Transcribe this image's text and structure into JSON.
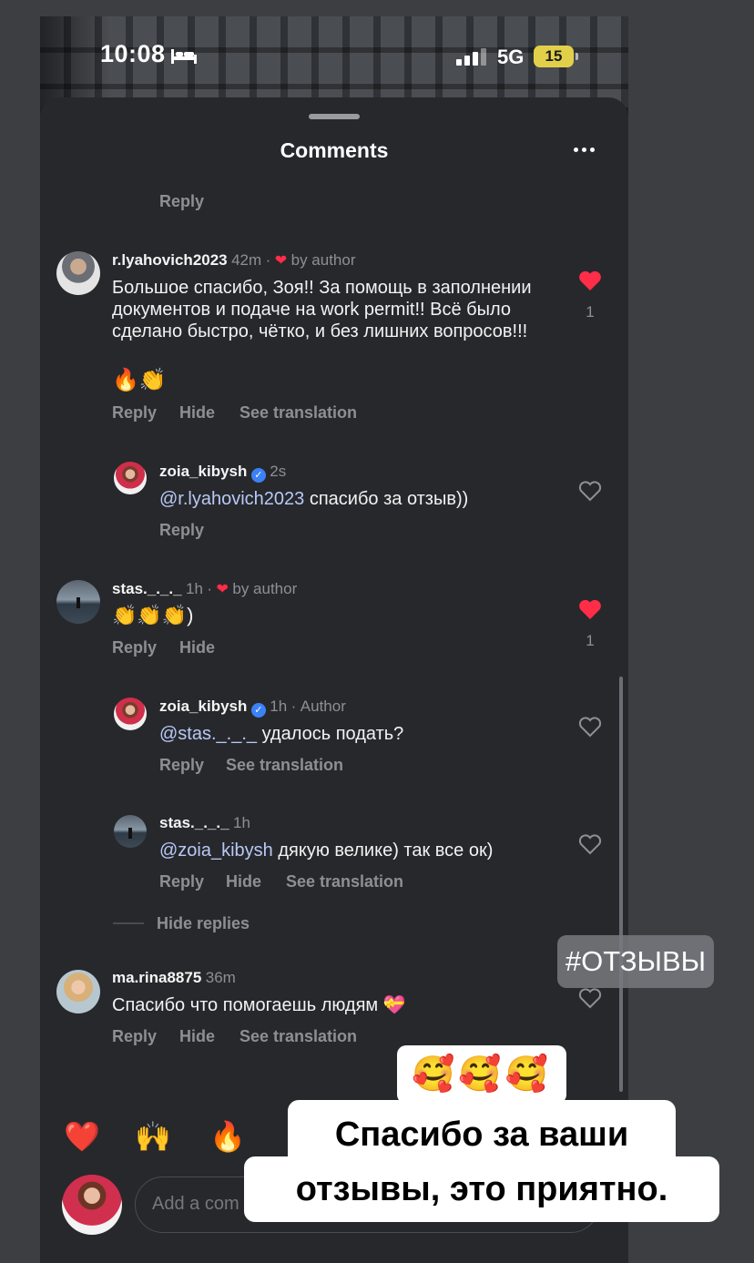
{
  "status_bar": {
    "time": "10:08",
    "network": "5G",
    "battery": "15"
  },
  "sheet": {
    "title": "Comments",
    "top_reply_label": "Reply"
  },
  "comments": [
    {
      "username": "r.lyahovich2023",
      "time": "42m",
      "liked_by_author": "by author",
      "text": "Большое спасибо, Зоя!! За помощь в заполнении документов и подаче на work permit!! Всё было сделано быстро, чётко, и без лишних вопросов!!!",
      "emojis": "🔥👏",
      "actions": [
        "Reply",
        "Hide",
        "See translation"
      ],
      "like_count": "1"
    },
    {
      "username": "zoia_kibysh",
      "time": "2s",
      "mention": "@r.lyahovich2023",
      "text": " спасибо за отзыв))",
      "actions": [
        "Reply"
      ]
    },
    {
      "username": "stas._._._",
      "time": "1h",
      "liked_by_author": "by author",
      "text": "👏👏👏)",
      "actions": [
        "Reply",
        "Hide"
      ],
      "like_count": "1"
    },
    {
      "username": "zoia_kibysh",
      "time": "1h",
      "author_label": "Author",
      "mention": "@stas._._._",
      "text": " удалось подать?",
      "actions": [
        "Reply",
        "See translation"
      ]
    },
    {
      "username": "stas._._._",
      "time": "1h",
      "mention": "@zoia_kibysh",
      "text": " дякую велике) так все ок)",
      "actions": [
        "Reply",
        "Hide",
        "See translation"
      ]
    },
    {
      "username": "ma.rina8875",
      "time": "36m",
      "text": "Спасибо что помогаешь людям 💝",
      "actions": [
        "Reply",
        "Hide",
        "See translation"
      ]
    }
  ],
  "hide_replies_label": "Hide replies",
  "quick_emojis": [
    "❤️",
    "🙌",
    "🔥"
  ],
  "input": {
    "placeholder": "Add a com"
  },
  "overlays": {
    "hashtag": "#ОТЗЫВЫ",
    "emoji_sticker": "🥰🥰🥰",
    "caption_line1": "Спасибо за ваши",
    "caption_line2": "отзывы, это приятно."
  },
  "colors": {
    "sheet": "#27282c",
    "like_red": "#ff2d48",
    "mention": "#b8c9f5",
    "verified": "#3b82f6"
  }
}
